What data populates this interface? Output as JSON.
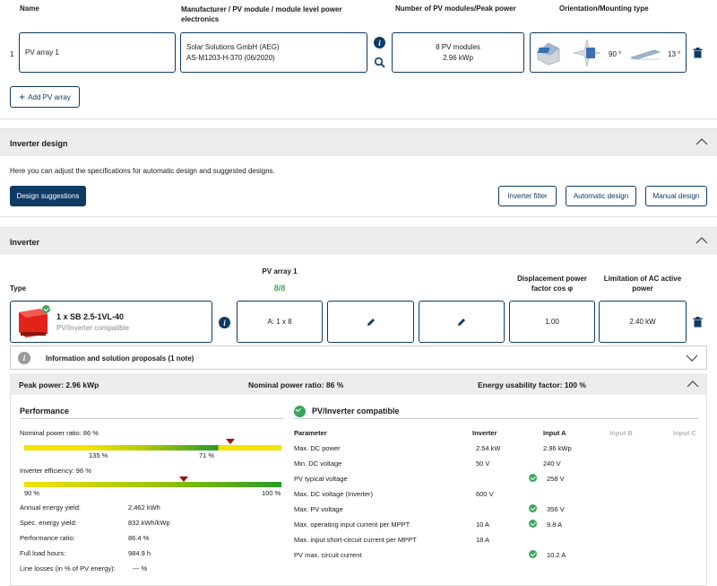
{
  "pv_table": {
    "headers": {
      "name": "Name",
      "manufacturer": "Manufacturer / PV module / module level power electronics",
      "modules": "Number of PV modules/Peak power",
      "orientation": "Orientation/Mounting type"
    },
    "row": {
      "index": "1",
      "name": "PV array 1",
      "manufacturer": "Solar Solutions GmbH (AEG)",
      "module": "AS-M1203-H-370 (06/2020)",
      "modules_count": "8 PV modules",
      "peak_power": "2.96 kWp",
      "azimuth": "90 °",
      "tilt": "13 °"
    },
    "add_button": "Add PV array"
  },
  "inverter_design": {
    "title": "Inverter design",
    "description": "Here you can adjust the specifications for automatic design and suggested designs.",
    "buttons": {
      "suggestions": "Design suggestions",
      "filter": "Inverter filter",
      "automatic": "Automatic design",
      "manual": "Manual design"
    }
  },
  "inverter": {
    "title": "Inverter",
    "type_label": "Type",
    "pv_array_header": "PV array 1",
    "pv_array_count": "8/8",
    "displacement_header": "Displacement power factor cos φ",
    "limitation_header": "Limitation of AC active power",
    "model": "1 x SB 2.5-1VL-40",
    "compat": "PV/Inverter compatible",
    "string_config": "A: 1 x 8",
    "cos_phi": "1.00",
    "ac_limit": "2.40 kW",
    "info_bar": "Information and solution proposals (1 note)"
  },
  "summary": {
    "peak_power": "Peak power: 2.96 kWp",
    "nominal_ratio": "Nominal power ratio: 86 %",
    "usability": "Energy usability factor: 100 %"
  },
  "performance": {
    "title": "Performance",
    "nominal_label": "Nominal power ratio: 86 %",
    "nominal_marker_value": 0.8,
    "nominal_low": "135 %",
    "nominal_high": "71 %",
    "efficiency_label": "Inverter efficiency: 96 %",
    "efficiency_marker_value": 0.62,
    "eff_low": "90 %",
    "eff_high": "100 %",
    "stats": [
      {
        "label": "Annual energy yield:",
        "value": "2,462 kWh"
      },
      {
        "label": "Spec. energy yield:",
        "value": "832 kWh/kWp"
      },
      {
        "label": "Performance ratio:",
        "value": "86.4 %"
      },
      {
        "label": "Full load hours:",
        "value": "984.9 h"
      },
      {
        "label": "Line losses (in % of PV energy):",
        "value": "--- %"
      }
    ]
  },
  "compat": {
    "title": "PV/Inverter compatible",
    "headers": {
      "parameter": "Parameter",
      "inverter": "Inverter",
      "input_a": "Input A",
      "input_b": "Input B",
      "input_c": "Input C"
    },
    "rows": [
      {
        "param": "Max. DC power",
        "inverter": "2.54 kW",
        "check": false,
        "input_a": "2.96 kWp"
      },
      {
        "param": "Min. DC voltage",
        "inverter": "50 V",
        "check": false,
        "input_a": "240 V"
      },
      {
        "param": "PV typical voltage",
        "inverter": "",
        "check": true,
        "input_a": "258 V"
      },
      {
        "param": "Max. DC voltage (Inverter)",
        "inverter": "600 V",
        "check": false,
        "input_a": ""
      },
      {
        "param": "Max. PV voltage",
        "inverter": "",
        "check": true,
        "input_a": "356 V"
      },
      {
        "param": "Max. operating input current per MPPT",
        "inverter": "10 A",
        "check": true,
        "input_a": "9.8 A"
      },
      {
        "param": "Max. input short-circuit current per MPPT",
        "inverter": "18 A",
        "check": false,
        "input_a": ""
      },
      {
        "param": "PV max. circuit current",
        "inverter": "",
        "check": true,
        "input_a": "10.2 A"
      }
    ]
  },
  "colors": {
    "navy": "#0f3a64",
    "green": "#3aa55d",
    "inverter_red": "#e2231a"
  }
}
